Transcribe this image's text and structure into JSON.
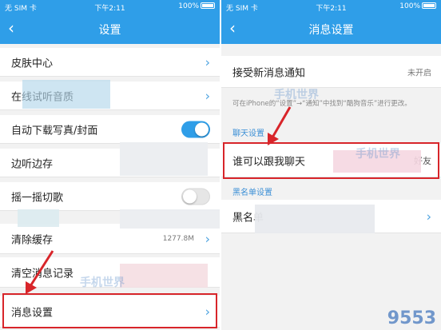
{
  "left": {
    "status": {
      "carrier": "无 SIM 卡",
      "time": "下午2:11",
      "battery": "100%"
    },
    "nav": {
      "title": "设置",
      "back": "‹"
    },
    "rows": {
      "skin_center": "皮肤中心",
      "online_audio_quality": "在线试听音质",
      "auto_download_cover": "自动下载写真/封面",
      "listen_while_cache": "边听边存",
      "shake_switch_song": "摇一摇切歌",
      "clear_cache": "清除缓存",
      "clear_cache_size": "1277.8M",
      "clear_message_history": "清空消息记录",
      "message_settings": "消息设置"
    },
    "toggles": {
      "auto_download_cover": true,
      "shake_switch_song": false
    }
  },
  "right": {
    "status": {
      "carrier": "无 SIM 卡",
      "time": "下午2:11",
      "battery": "100%"
    },
    "nav": {
      "title": "消息设置",
      "back": "‹"
    },
    "rows": {
      "receive_notifications": "接受新消息通知",
      "receive_notifications_value": "未开启",
      "who_can_chat": "谁可以跟我聊天",
      "who_can_chat_value": "好友",
      "blacklist": "黑名单"
    },
    "note": "可在iPhone的“设置”→“通知”中找到“酷狗音乐”进行更改。",
    "sections": {
      "chat_settings": "聊天设置",
      "blacklist_settings": "黑名单设置"
    }
  },
  "watermark": "手机世界",
  "site_logo": "9553",
  "colors": {
    "nav_blue": "#2f9ee8",
    "highlight_red": "#d8252a",
    "chevron_blue": "#4ea3e0"
  }
}
